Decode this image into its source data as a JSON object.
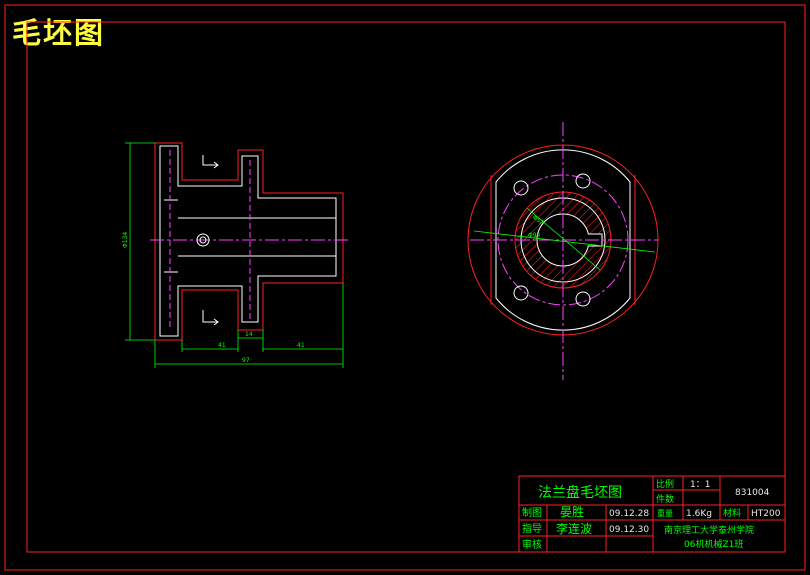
{
  "drawing": {
    "sheet_title": "毛坯图",
    "dimensions": {
      "left_width": "41",
      "mid_width": "14",
      "right_width": "41",
      "total_width": "97",
      "height": "Φ134",
      "hole_dia_1": "Φ94",
      "hole_dia_2": "Φ52"
    }
  },
  "title_block": {
    "part_name": "法兰盘毛坯图",
    "scale_label": "比例",
    "scale_value": "1：1",
    "qty_label": "件数",
    "drawing_no": "831004",
    "made_label": "制图",
    "made_name": "晏胜",
    "made_date": "09.12.28",
    "weight_label": "重量",
    "weight_value": "1.6Kg",
    "material_label": "材料",
    "material_value": "HT200",
    "guide_label": "指导",
    "guide_name": "李连波",
    "guide_date": "09.12.30",
    "school": "南京理工大学泰州学院",
    "class_name": "06机机械Z1班",
    "review_label": "审核"
  },
  "colors": {
    "outline": "#ff2020",
    "body": "#ffffff",
    "dimension": "#00ff00",
    "center": "#ff40ff",
    "hatch": "#ff2020",
    "title": "#ffff40"
  }
}
